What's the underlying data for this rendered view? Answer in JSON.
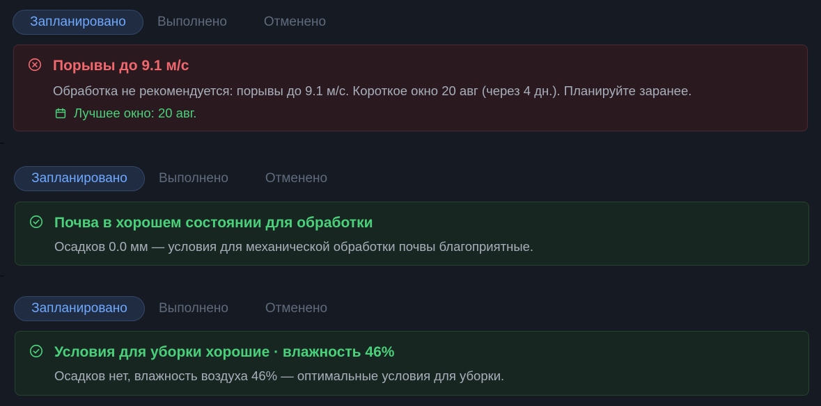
{
  "items": [
    {
      "tabs": [
        {
          "label": "Запланировано",
          "active": true
        },
        {
          "label": "Выполнено",
          "active": false
        },
        {
          "label": "Отменено",
          "active": false
        }
      ],
      "card": {
        "status": "danger",
        "icon": "x-circle-icon",
        "title": "Порывы до 9.1 м/с",
        "text": "Обработка не рекомендуется: порывы до 9.1 м/с. Короткое окно 20 авг (через 4 дн.). Планируйте заранее.",
        "best_window_icon": "calendar-icon",
        "best_window": "Лучшее окно: 20 авг."
      }
    },
    {
      "tabs": [
        {
          "label": "Запланировано",
          "active": true
        },
        {
          "label": "Выполнено",
          "active": false
        },
        {
          "label": "Отменено",
          "active": false
        }
      ],
      "card": {
        "status": "ok",
        "icon": "check-circle-icon",
        "title": "Почва в хорошем состоянии для обработки",
        "text": "Осадков 0.0 мм — условия для механической обработки почвы благоприятные."
      }
    },
    {
      "tabs": [
        {
          "label": "Запланировано",
          "active": true
        },
        {
          "label": "Выполнено",
          "active": false
        },
        {
          "label": "Отменено",
          "active": false
        }
      ],
      "card": {
        "status": "ok",
        "icon": "check-circle-icon",
        "title": "Условия для уборки хорошие · влажность 46%",
        "text": "Осадков нет, влажность воздуха 46% — оптимальные условия для уборки."
      }
    }
  ],
  "colors": {
    "background": "#161a22",
    "active_tab_text": "#6ea8ff",
    "inactive_tab_text": "#5f6b7c",
    "danger": "#f0686e",
    "success": "#4ad07a",
    "body_text": "#a8afbb"
  }
}
